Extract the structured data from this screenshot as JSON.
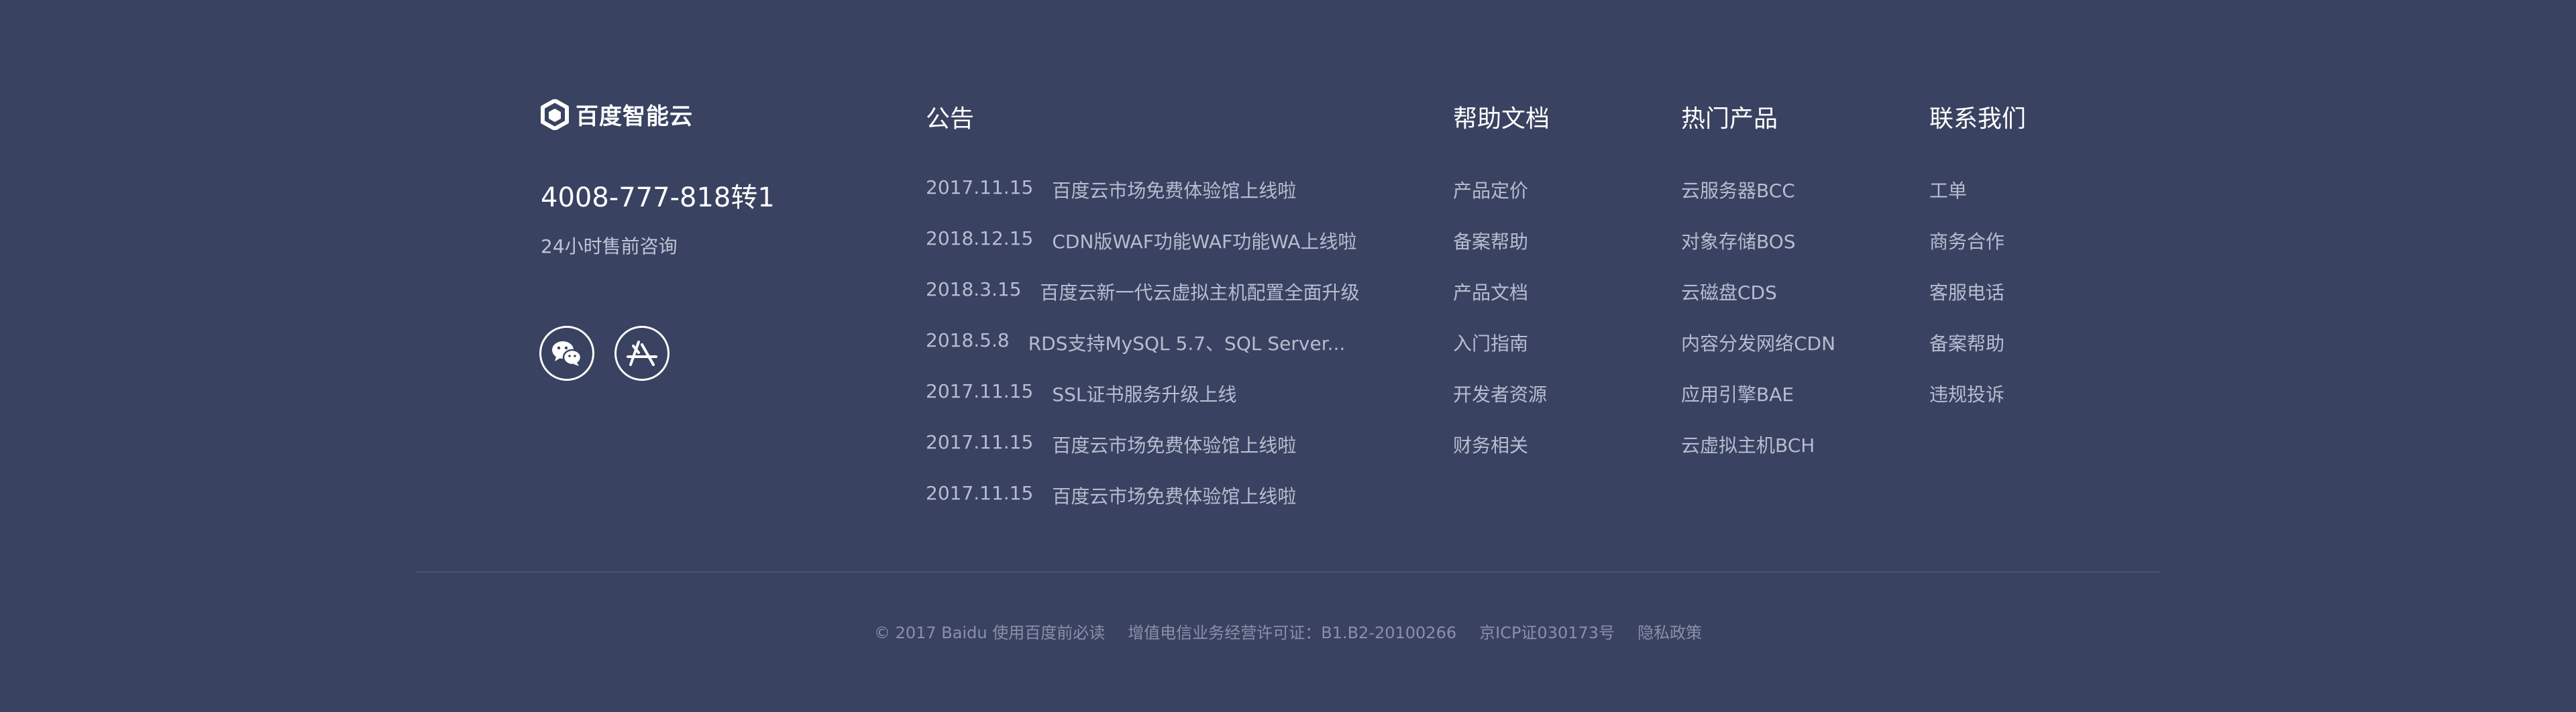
{
  "brand": {
    "name": "百度智能云",
    "hotline": "4008-777-818转1",
    "hotline_note": "24小时售前咨询",
    "social": [
      {
        "icon": "wechat-icon"
      },
      {
        "icon": "app-store-icon"
      }
    ]
  },
  "announcements": {
    "title": "公告",
    "items": [
      {
        "date": "2017.11.15",
        "text": "百度云市场免费体验馆上线啦"
      },
      {
        "date": "2018.12.15",
        "text": "CDN版WAF功能WAF功能WA上线啦"
      },
      {
        "date": "2018.3.15",
        "text": "百度云新一代云虚拟主机配置全面升级"
      },
      {
        "date": "2018.5.8",
        "text": "RDS支持MySQL 5.7、SQL Server..."
      },
      {
        "date": "2017.11.15",
        "text": "SSL证书服务升级上线"
      },
      {
        "date": "2017.11.15",
        "text": "百度云市场免费体验馆上线啦"
      },
      {
        "date": "2017.11.15",
        "text": "百度云市场免费体验馆上线啦"
      }
    ]
  },
  "help_docs": {
    "title": "帮助文档",
    "items": [
      "产品定价",
      "备案帮助",
      "产品文档",
      "入门指南",
      "开发者资源",
      "财务相关"
    ]
  },
  "hot_products": {
    "title": "热门产品",
    "items": [
      "云服务器BCC",
      "对象存储BOS",
      "云磁盘CDS",
      "内容分发网络CDN",
      "应用引擎BAE",
      "云虚拟主机BCH"
    ]
  },
  "contact": {
    "title": "联系我们",
    "items": [
      "工单",
      "商务合作",
      "客服电话",
      "备案帮助",
      "违规投诉"
    ]
  },
  "bottom": {
    "copyright": "© 2017 Baidu",
    "terms": "使用百度前必读",
    "license": "增值电信业务经营许可证：B1.B2-20100266",
    "icp": "京ICP证030173号",
    "privacy": "隐私政策"
  },
  "colors": {
    "background": "#394260",
    "heading": "#ffffff",
    "link": "#b7bdd0",
    "muted": "#8a90a8"
  }
}
